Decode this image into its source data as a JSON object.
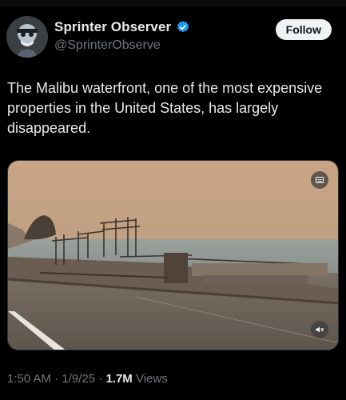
{
  "author": {
    "display_name": "Sprinter Observer",
    "handle": "@SprinterObserve",
    "verified": true
  },
  "follow_button": {
    "label": "Follow"
  },
  "tweet": {
    "text": "The Malibu waterfront, one of the most expensive properties in the United States, has largely disappeared."
  },
  "media": {
    "type": "video",
    "controls": {
      "caption_icon": "captions-icon",
      "mute_icon": "volume-muted-icon"
    }
  },
  "meta": {
    "time": "1:50 AM",
    "date": "1/9/25",
    "views_count": "1.7M",
    "views_label": "Views",
    "separator": "·"
  },
  "colors": {
    "background": "#000000",
    "text_primary": "#e7e9ea",
    "text_secondary": "#71767b",
    "verified_blue": "#1d9bf0",
    "follow_bg": "#eff3f4"
  }
}
